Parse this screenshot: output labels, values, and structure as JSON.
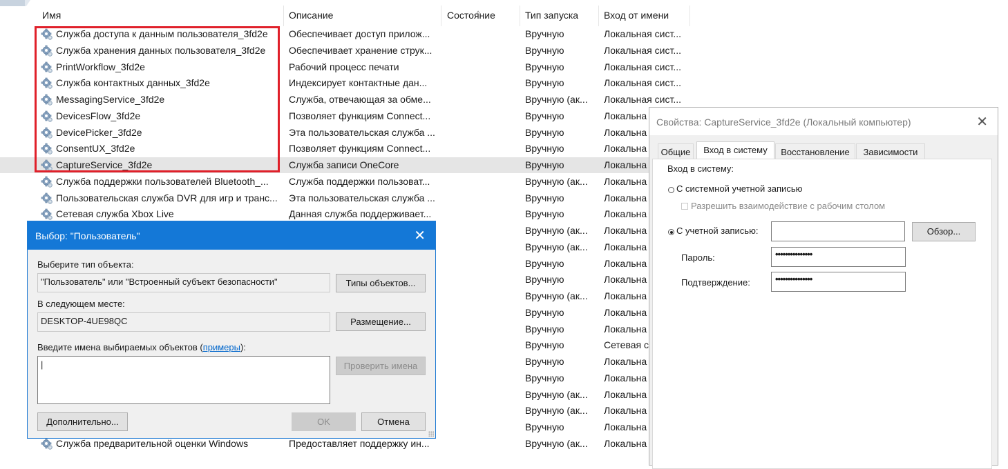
{
  "columns": {
    "name": "Имя",
    "description": "Описание",
    "status": "Состояние",
    "startup": "Тип запуска",
    "logon": "Вход от имени"
  },
  "services": [
    {
      "name": "Служба доступа к данным пользователя_3fd2e",
      "description": "Обеспечивает доступ прилож...",
      "startup": "Вручную",
      "logon": "Локальная сист..."
    },
    {
      "name": "Служба хранения данных пользователя_3fd2e",
      "description": "Обеспечивает хранение струк...",
      "startup": "Вручную",
      "logon": "Локальная сист..."
    },
    {
      "name": "PrintWorkflow_3fd2e",
      "description": "Рабочий процесс печати",
      "startup": "Вручную",
      "logon": "Локальная сист..."
    },
    {
      "name": "Служба контактных данных_3fd2e",
      "description": "Индексирует контактные дан...",
      "startup": "Вручную",
      "logon": "Локальная сист..."
    },
    {
      "name": "MessagingService_3fd2e",
      "description": "Служба, отвечающая за обме...",
      "startup": "Вручную (ак...",
      "logon": "Локальная сист..."
    },
    {
      "name": "DevicesFlow_3fd2e",
      "description": "Позволяет функциям Connect...",
      "startup": "Вручную",
      "logon": "Локальна"
    },
    {
      "name": "DevicePicker_3fd2e",
      "description": "Эта пользовательская служба ...",
      "startup": "Вручную",
      "logon": "Локальна"
    },
    {
      "name": "ConsentUX_3fd2e",
      "description": "Позволяет функциям Connect...",
      "startup": "Вручную",
      "logon": "Локальна"
    },
    {
      "name": "CaptureService_3fd2e",
      "description": "Служба записи OneCore",
      "startup": "Вручную",
      "logon": "Локальна"
    },
    {
      "name": "Служба поддержки пользователей Bluetooth_...",
      "description": "Служба поддержки пользоват...",
      "startup": "Вручную (ак...",
      "logon": "Локальна"
    },
    {
      "name": "Пользовательская служба DVR для игр и транс...",
      "description": "Эта пользовательская служба ...",
      "startup": "Вручную",
      "logon": "Локальна"
    },
    {
      "name": "Сетевая служба Xbox Live",
      "description": "Данная служба поддерживает...",
      "startup": "Вручную",
      "logon": "Локальна"
    },
    {
      "name": "",
      "description": "",
      "startup": "Вручную (ак...",
      "logon": "Локальна"
    },
    {
      "name": "",
      "description": "",
      "startup": "Вручную (ак...",
      "logon": "Локальна"
    },
    {
      "name": "",
      "description": "",
      "startup": "Вручную",
      "logon": "Локальна"
    },
    {
      "name": "",
      "description": "",
      "startup": "Вручную",
      "logon": "Локальна"
    },
    {
      "name": "",
      "description": "",
      "startup": "Вручную (ак...",
      "logon": "Локальна"
    },
    {
      "name": "",
      "description": "",
      "startup": "Вручную",
      "logon": "Локальна"
    },
    {
      "name": "",
      "description": "",
      "startup": "Вручную",
      "logon": "Локальна"
    },
    {
      "name": "",
      "description": "",
      "startup": "Вручную",
      "logon": "Сетевая с"
    },
    {
      "name": "",
      "description": "",
      "startup": "Вручную",
      "logon": "Локальна"
    },
    {
      "name": "",
      "description": "",
      "startup": "Вручную",
      "logon": "Локальна"
    },
    {
      "name": "",
      "description": "",
      "startup": "Вручную (ак...",
      "logon": "Локальна"
    },
    {
      "name": "",
      "description": "",
      "startup": "Вручную (ак...",
      "logon": "Локальна"
    },
    {
      "name": "",
      "description": "",
      "startup": "Вручную",
      "logon": "Локальна"
    },
    {
      "name": "Служба предварительной оценки Windows",
      "description": "Предоставляет поддержку ин...",
      "startup": "Вручную (ак...",
      "logon": "Локальна"
    }
  ],
  "select_user_dialog": {
    "title": "Выбор: \"Пользователь\"",
    "close": "✕",
    "object_type_label": "Выберите тип объекта:",
    "object_type_value": "\"Пользователь\" или \"Встроенный субъект безопасности\"",
    "object_types_button": "Типы объектов...",
    "location_label": "В следующем месте:",
    "location_value": "DESKTOP-4UE98QC",
    "locations_button": "Размещение...",
    "enter_names_label": "Введите имена выбираемых объектов (",
    "examples_link": "примеры",
    "enter_names_suffix": "):",
    "check_names_button": "Проверить имена",
    "advanced_button": "Дополнительно...",
    "ok_button": "OK",
    "cancel_button": "Отмена"
  },
  "properties_dialog": {
    "title": "Свойства: CaptureService_3fd2e (Локальный компьютер)",
    "close": "✕",
    "tabs": [
      "Общие",
      "Вход в систему",
      "Восстановление",
      "Зависимости"
    ],
    "active_tab": "Вход в систему",
    "logon_header": "Вход в систему:",
    "system_account": "С системной учетной записью",
    "allow_desktop": "Разрешить взаимодействие с рабочим столом",
    "this_account": "С учетной записью:",
    "account_value": "",
    "browse_button": "Обзор...",
    "password_label": "Пароль:",
    "password_value": "•••••••••••••••",
    "confirm_label": "Подтверждение:",
    "confirm_value": "•••••••••••••••"
  }
}
